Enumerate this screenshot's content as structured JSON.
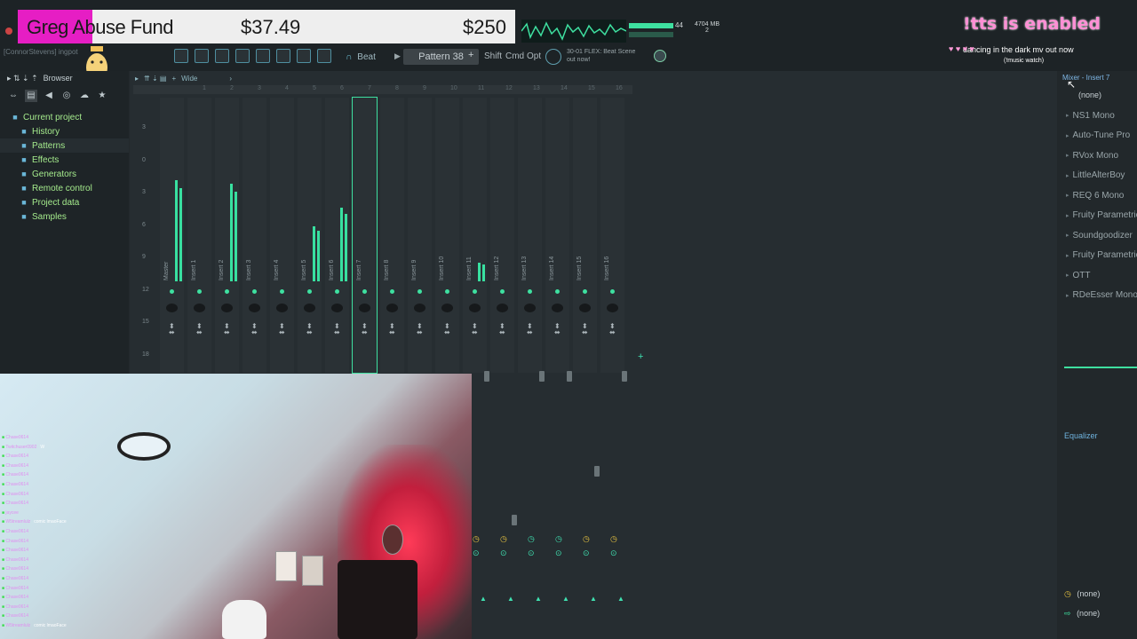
{
  "overlay": {
    "fund_title": "Greg Abuse Fund",
    "fund_amount": "$37.49",
    "fund_goal": "$250",
    "tts_status": "!tts is enabled",
    "song_title": "dancing in the dark mv out now",
    "song_sub": "(!music watch)"
  },
  "user": {
    "line": "[ConnorStevens] ingpot"
  },
  "toolbar": {
    "mode_label": "Beat",
    "pattern_label": "Pattern 38",
    "shift": "Shift",
    "cmd": "Cmd",
    "opt": "Opt",
    "hint_line1": "30-01  FLEX: Beat Scene",
    "hint_line2": "out now!",
    "cpu_value": "44",
    "memory": "4704 MB",
    "poly": "2"
  },
  "browser": {
    "title": "Browser",
    "items": [
      {
        "label": "Current project",
        "icon": "folder-icon"
      },
      {
        "label": "History",
        "icon": "history-icon"
      },
      {
        "label": "Patterns",
        "icon": "note-icon"
      },
      {
        "label": "Effects",
        "icon": "plug-icon"
      },
      {
        "label": "Generators",
        "icon": "keyboard-icon"
      },
      {
        "label": "Remote control",
        "icon": "remote-icon"
      },
      {
        "label": "Project data",
        "icon": "data-icon"
      },
      {
        "label": "Samples",
        "icon": "waveform-icon"
      }
    ]
  },
  "mixer": {
    "view_label": "Wide",
    "db_scale": [
      "3",
      "0",
      "3",
      "6",
      "9",
      "12",
      "15",
      "18"
    ],
    "ruler_numbers": [
      "1",
      "2",
      "3",
      "4",
      "5",
      "6",
      "7",
      "8",
      "9",
      "10",
      "11",
      "12",
      "13",
      "14",
      "15",
      "16"
    ],
    "tracks": [
      {
        "name": "Master",
        "level": 0.55
      },
      {
        "name": "Insert 1",
        "level": 0
      },
      {
        "name": "Insert 2",
        "level": 0.53
      },
      {
        "name": "Insert 3",
        "level": 0
      },
      {
        "name": "Insert 4",
        "level": 0
      },
      {
        "name": "Insert 5",
        "level": 0.3
      },
      {
        "name": "Insert 6",
        "level": 0.4
      },
      {
        "name": "Insert 7",
        "level": 0
      },
      {
        "name": "Insert 8",
        "level": 0
      },
      {
        "name": "Insert 9",
        "level": 0
      },
      {
        "name": "Insert 10",
        "level": 0
      },
      {
        "name": "Insert 11",
        "level": 0.1
      },
      {
        "name": "Insert 12",
        "level": 0
      },
      {
        "name": "Insert 13",
        "level": 0
      },
      {
        "name": "Insert 14",
        "level": 0
      },
      {
        "name": "Insert 15",
        "level": 0
      },
      {
        "name": "Insert 16",
        "level": 0
      }
    ]
  },
  "insert_panel": {
    "title": "Mixer - Insert 7",
    "top_slot": "(none)",
    "slots": [
      "NS1 Mono",
      "Auto-Tune Pro",
      "RVox Mono",
      "LittleAlterBoy",
      "REQ 6 Mono",
      "Fruity Parametric",
      "Soundgoodizer",
      "Fruity Parametric",
      "OTT",
      "RDeEsser Mono"
    ],
    "eq_label": "Equalizer",
    "route_in": "(none)",
    "route_out": "(none)"
  },
  "chat": {
    "lines": [
      {
        "user": "Chase0614",
        "msg": ""
      },
      {
        "user": "Twitchuser0902",
        "msg": "W"
      },
      {
        "user": "Chase0614",
        "msg": ""
      },
      {
        "user": "Chase0614",
        "msg": ""
      },
      {
        "user": "Chase0614",
        "msg": ""
      },
      {
        "user": "Chase0614",
        "msg": ""
      },
      {
        "user": "Chase0614",
        "msg": ""
      },
      {
        "user": "Chase0614",
        "msg": ""
      },
      {
        "user": "jaycee",
        "msg": ""
      },
      {
        "user": "W5treamlulz",
        "msg": "comic lmaoFace"
      },
      {
        "user": "Chase0614",
        "msg": ""
      },
      {
        "user": "Chase0614",
        "msg": ""
      },
      {
        "user": "Chase0614",
        "msg": ""
      },
      {
        "user": "Chase0614",
        "msg": ""
      },
      {
        "user": "Chase0614",
        "msg": ""
      },
      {
        "user": "Chase0614",
        "msg": ""
      },
      {
        "user": "Chase0614",
        "msg": ""
      },
      {
        "user": "Chase0614",
        "msg": ""
      },
      {
        "user": "Chase0614",
        "msg": ""
      },
      {
        "user": "Chase0614",
        "msg": ""
      },
      {
        "user": "W5treamlulz",
        "msg": "comic lmaoFace"
      }
    ]
  },
  "colors": {
    "accent": "#38e0a0",
    "pink": "#e61ec4",
    "panel": "#262d31"
  }
}
